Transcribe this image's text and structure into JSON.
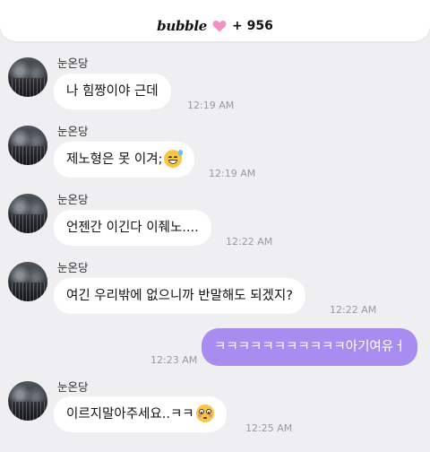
{
  "header": {
    "brand": "bubble",
    "count": "+ 956",
    "heart_color": "#f48fc4"
  },
  "colors": {
    "background": "#efeff1",
    "incoming_bubble": "#ffffff",
    "outgoing_bubble": "#a88cf0"
  },
  "messages": [
    {
      "sender": "눈온당",
      "text": "나 힘짱이야 근데",
      "time": "12:19 AM",
      "emoji": ""
    },
    {
      "sender": "눈온당",
      "text": "제노형은 못 이겨;",
      "time": "12:19 AM",
      "emoji": "sweat-smile-emoji"
    },
    {
      "sender": "눈온당",
      "text": "언젠간 이긴다 이줴노....",
      "time": "12:22 AM",
      "emoji": ""
    },
    {
      "sender": "눈온당",
      "text": "여긴 우리밖에 없으니까 반말해도 되겠지?",
      "time": "12:22 AM",
      "emoji": ""
    },
    {
      "sender": "",
      "text": "ㅋㅋㅋㅋㅋㅋㅋㅋㅋㅋㅋ아기여유ㅓ",
      "time": "12:23 AM",
      "emoji": ""
    },
    {
      "sender": "눈온당",
      "text": "이르지말아주세요..ㅋㅋ",
      "time": "12:25 AM",
      "emoji": "flushed-emoji"
    }
  ]
}
